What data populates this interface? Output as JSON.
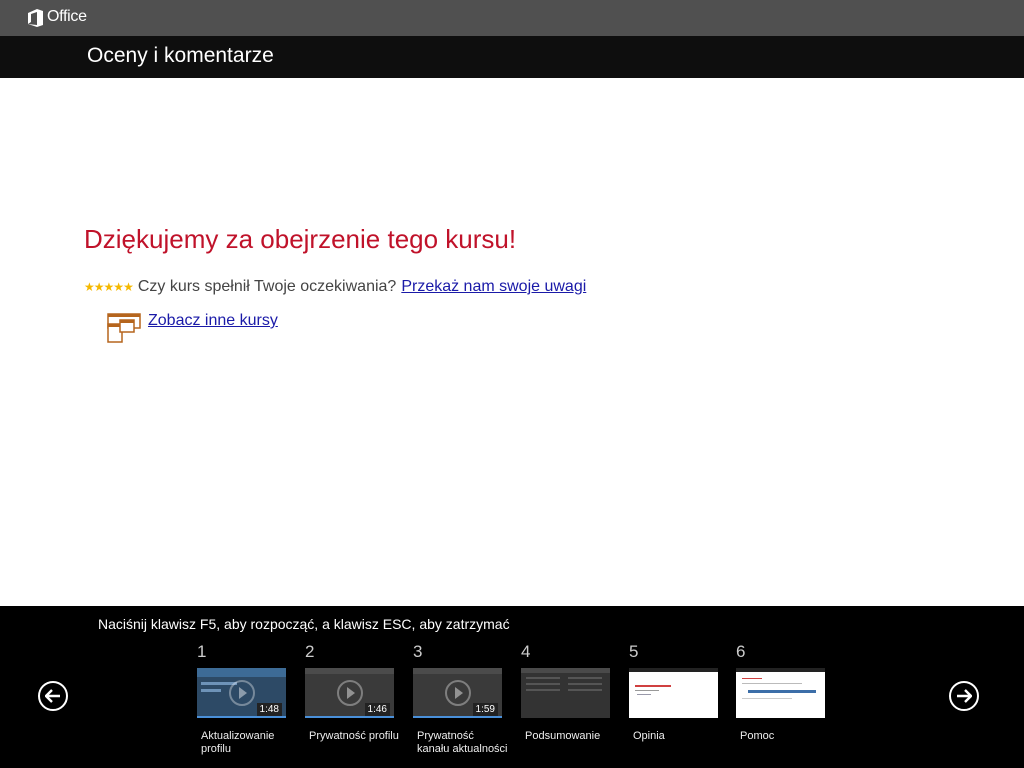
{
  "topbar": {
    "brand": "Office"
  },
  "header": {
    "title": "Oceny i komentarze"
  },
  "main": {
    "heading": "Dziękujemy za obejrzenie tego kursu!",
    "rating_stars": 5,
    "question": "Czy kurs spełnił Twoje oczekiwania?",
    "feedback_link": "Przekaż nam swoje uwagi",
    "courses_link": "Zobacz inne kursy"
  },
  "footer": {
    "hint": "Naciśnij klawisz F5, aby rozpocząć, a klawisz ESC, aby zatrzymać",
    "slides": [
      {
        "number": "1",
        "label": "Aktualizowanie profilu",
        "duration": "1:48",
        "progress": 1.0
      },
      {
        "number": "2",
        "label": "Prywatność profilu",
        "duration": "1:46",
        "progress": 1.0
      },
      {
        "number": "3",
        "label": "Prywatność kanału aktualności",
        "duration": "1:59",
        "progress": 1.0
      },
      {
        "number": "4",
        "label": "Podsumowanie"
      },
      {
        "number": "5",
        "label": "Opinia"
      },
      {
        "number": "6",
        "label": "Pomoc"
      }
    ]
  },
  "colors": {
    "heading": "#c0122a",
    "link": "#1a1aa8",
    "star": "#f5b800",
    "progress": "#4a90d9"
  }
}
